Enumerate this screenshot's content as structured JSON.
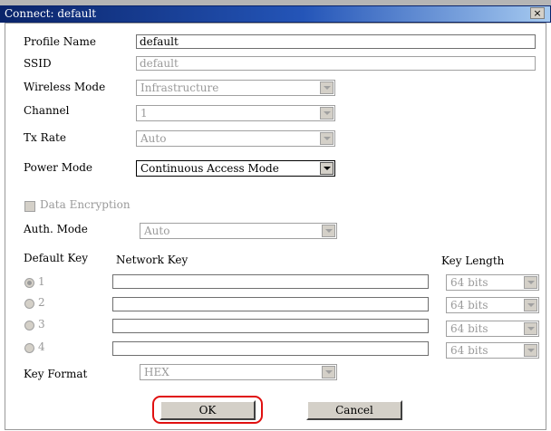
{
  "window": {
    "title": "Connect: default",
    "close_glyph": "×"
  },
  "fields": {
    "profile_name": {
      "label": "Profile Name",
      "value": "default"
    },
    "ssid": {
      "label": "SSID",
      "value": "default"
    },
    "wireless_mode": {
      "label": "Wireless Mode",
      "value": "Infrastructure"
    },
    "channel": {
      "label": "Channel",
      "value": "1"
    },
    "tx_rate": {
      "label": "Tx Rate",
      "value": "Auto"
    },
    "power_mode": {
      "label": "Power Mode",
      "value": "Continuous Access Mode"
    },
    "data_encryption": {
      "label": "Data Encryption",
      "checked": false
    },
    "auth_mode": {
      "label": "Auth. Mode",
      "value": "Auto"
    },
    "key_format": {
      "label": "Key Format",
      "value": "HEX"
    }
  },
  "keys": {
    "default_key_label": "Default Key",
    "network_key_label": "Network Key",
    "key_length_label": "Key Length",
    "selected": "1",
    "rows": [
      {
        "index": "1",
        "value": "",
        "length": "64 bits"
      },
      {
        "index": "2",
        "value": "",
        "length": "64 bits"
      },
      {
        "index": "3",
        "value": "",
        "length": "64 bits"
      },
      {
        "index": "4",
        "value": "",
        "length": "64 bits"
      }
    ]
  },
  "buttons": {
    "ok": "OK",
    "cancel": "Cancel"
  },
  "colors": {
    "titlebar": "#0a246a",
    "face": "#d4d0c8",
    "highlight": "#e01010"
  }
}
